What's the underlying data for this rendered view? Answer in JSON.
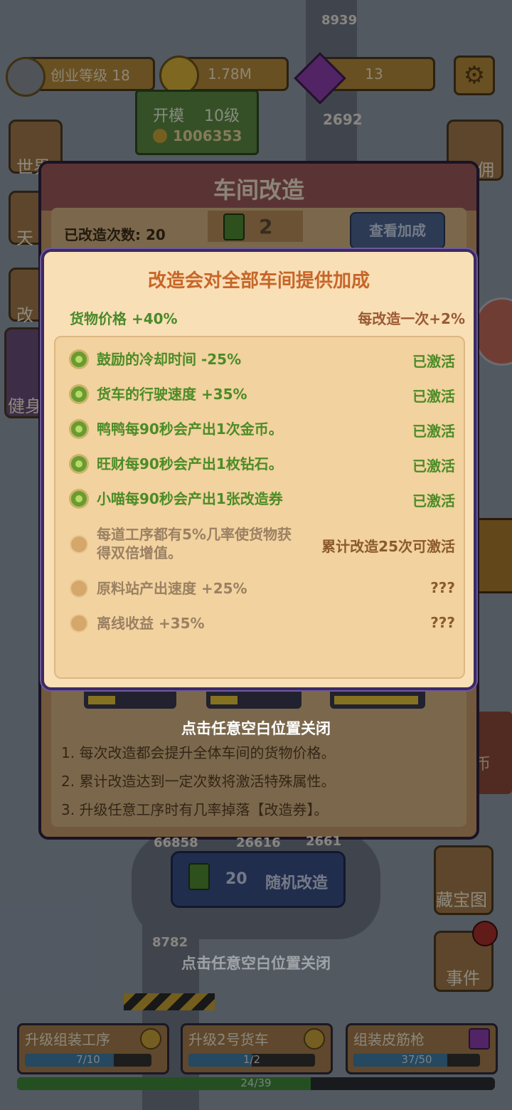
{
  "hud": {
    "level_label": "创业等级 18",
    "coins": "1.78M",
    "gems": "13"
  },
  "scene": {
    "mold_title": "开模",
    "mold_level": "10级",
    "mold_cost": "1006353",
    "numbers_top": [
      "8939"
    ],
    "gem_pile_count": "2692",
    "lower_numbers": [
      "66858",
      "26616",
      "2661"
    ],
    "left_count": "8782"
  },
  "side_buttons": {
    "world": "世界",
    "sky": "天",
    "renovate": "改",
    "gym": "健身",
    "hire": "佣",
    "treasure_map": "藏宝图",
    "events": "事件",
    "shop_partial": "币"
  },
  "panel": {
    "title": "车间改造",
    "renovate_count_label": "已改造次数: 20",
    "ticket_count": "2",
    "view_bonus_button": "查看加成",
    "rules": [
      "1. 每次改造都会提升全体车间的货物价格。",
      "2. 累计改造达到一定次数将激活特殊属性。",
      "3. 升级任意工序时有几率掉落【改造券】。"
    ],
    "random_ticket_count": "20",
    "random_button": "随机改造"
  },
  "dialog": {
    "title": "改造会对全部车间提供加成",
    "goods_price": "货物价格 +40%",
    "per_renovate": "每改造一次+2%",
    "items": [
      {
        "text": "鼓励的冷却时间 -25%",
        "status": "已激活",
        "active": true
      },
      {
        "text": "货车的行驶速度 +35%",
        "status": "已激活",
        "active": true
      },
      {
        "text": "鸭鸭每90秒会产出1次金币。",
        "status": "已激活",
        "active": true
      },
      {
        "text": "旺财每90秒会产出1枚钻石。",
        "status": "已激活",
        "active": true
      },
      {
        "text": "小喵每90秒会产出1张改造券",
        "status": "已激活",
        "active": true
      },
      {
        "text": "每道工序都有5%几率使货物获得双倍增值。",
        "status": "累计改造25次可激活",
        "active": false
      },
      {
        "text": "原料站产出速度 +25%",
        "status": "???",
        "active": false
      },
      {
        "text": "离线收益 +35%",
        "status": "???",
        "active": false
      }
    ]
  },
  "close_hint": "点击任意空白位置关闭",
  "tasks": [
    {
      "title": "升级组装工序",
      "progress_text": "7/10",
      "progress": 0.7
    },
    {
      "title": "升级2号货车",
      "progress_text": "1/2",
      "progress": 0.5
    },
    {
      "title": "组装皮筋枪",
      "progress_text": "37/50",
      "progress": 0.74
    }
  ],
  "overall_progress": {
    "text": "24/39",
    "progress": 0.615
  },
  "colors": {
    "active_green": "#4b8c26",
    "dialog_bg": "#f9dfb6",
    "title_orange": "#c6662a"
  }
}
